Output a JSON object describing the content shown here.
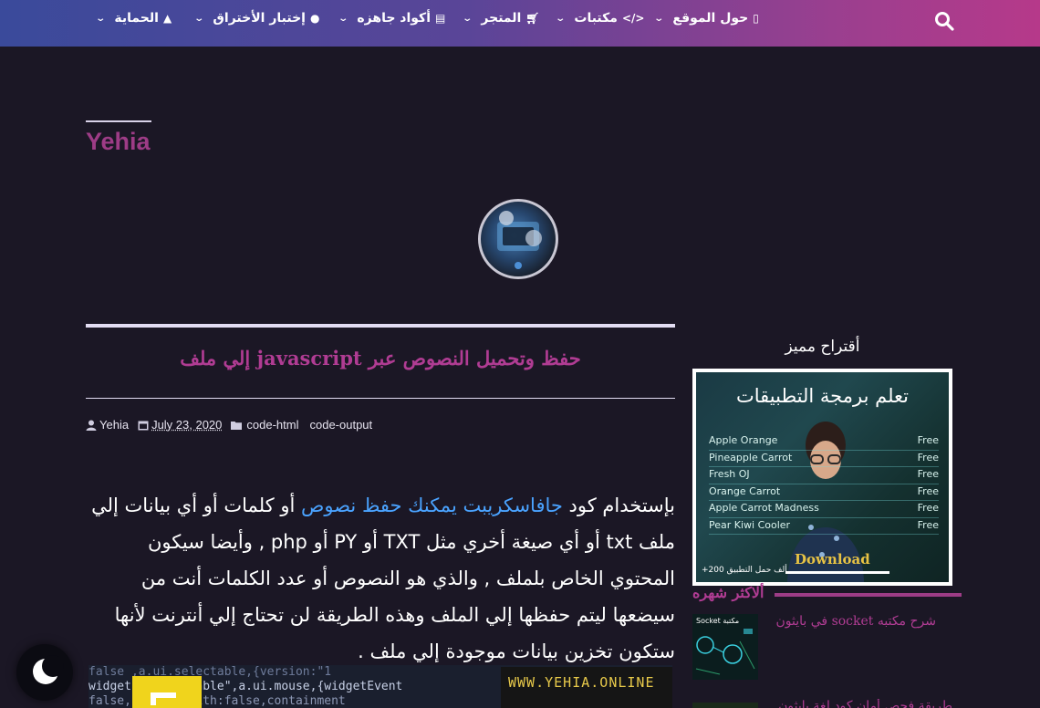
{
  "nav": {
    "items": [
      {
        "label": "حول الموقع",
        "icon": "info-icon"
      },
      {
        "label": "مكتبات",
        "icon": "code-icon"
      },
      {
        "label": "المتجر",
        "icon": "cart-icon"
      },
      {
        "label": "أكواد جاهزه",
        "icon": "file-code-icon"
      },
      {
        "label": "إختبار الأختراق",
        "icon": "user-shield-icon"
      },
      {
        "label": "الحماية",
        "icon": "user-secret-icon"
      }
    ]
  },
  "blog": {
    "title": "Yehia"
  },
  "post": {
    "title": "حفظ وتحميل النصوص عبر javascript إلي ملف",
    "meta": {
      "author": "Yehia",
      "date": "July 23, 2020",
      "labels": [
        "code-html",
        "code-output"
      ]
    },
    "body_start": "بإستخدام كود ",
    "body_link": "جافاسكريبت يمكنك حفظ نصوص",
    "body_rest": " أو كلمات أو أي بيانات إلي ملف txt أو أي صيغة أخري مثل TXT أو PY أو php , وأيضا سيكون المحتوي الخاص بلملف , والذي هو النصوص أو عدد الكلمات أنت من سيضعها ليتم حفظها إلي الملف وهذه الطريقة لن تحتاج إلي أنترنت لأنها ستكون تخزين بيانات موجودة إلي ملف .",
    "thumbnail": {
      "site": "WWW.YEHIA.ONLINE",
      "code_line_1": "false                  ,a.ui.selectable,{version:\"1",
      "code_line_2": "widget(\"ui.sortable\",a.ui.mouse,{widgetEvent",
      "code_line_3": "false,        connectWith:false,containment"
    }
  },
  "sidebar": {
    "featured_heading": "أقتراح مميز",
    "ad": {
      "headline": "تعلم برمجة التطبيقات",
      "rows": [
        {
          "name": "Apple Orange",
          "price": "Free"
        },
        {
          "name": "Pineapple Carrot",
          "price": "Free"
        },
        {
          "name": "Fresh OJ",
          "price": "Free"
        },
        {
          "name": "Orange Carrot",
          "price": "Free"
        },
        {
          "name": "Apple Carrot Madness",
          "price": "Free"
        },
        {
          "name": "Pear Kiwi Cooler",
          "price": "Free"
        }
      ],
      "download": "Download",
      "downloads_note": "+200 ألف حمل التطبيق"
    },
    "popular_heading": "ألاكثر شهره",
    "popular_items": [
      {
        "title": "شرح مكتبه socket في بايثون",
        "thumb_label": "Socket مكتبة"
      },
      {
        "title": "طريقة فحص أمان كود لغة بايثون"
      }
    ]
  }
}
